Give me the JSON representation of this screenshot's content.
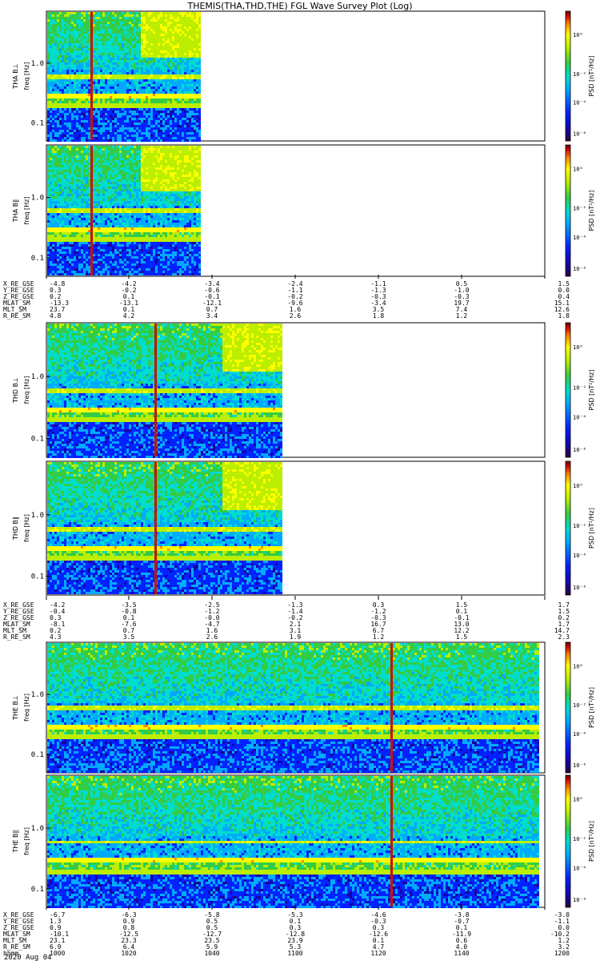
{
  "title": "THEMIS(THA,THD,THE) FGL Wave Survey Plot (Log)",
  "colors": {
    "colormap": [
      "#2a0033",
      "#1a00a0",
      "#0022ff",
      "#00aaff",
      "#00ddcc",
      "#33cc44",
      "#bbee00",
      "#ffff00",
      "#ff8800",
      "#cc1100",
      "#660000"
    ]
  },
  "panels": [
    {
      "ylabel_probe": "THA B⊥",
      "ylabel_unit": "freq [Hz]",
      "cb_label": "PSD [nT²/Hz]",
      "yticks": [
        "1.0",
        "0.1"
      ],
      "cb_ticks": [
        "10⁰",
        "10⁻²",
        "10⁻⁴",
        "10⁻⁶"
      ],
      "data_end_fraction": 0.305
    },
    {
      "ylabel_probe": "THA B∥",
      "ylabel_unit": "freq [Hz]",
      "cb_label": "PSD [nT²/Hz]",
      "yticks": [
        "1.0",
        "0.1"
      ],
      "cb_ticks": [
        "10⁰",
        "10⁻²",
        "10⁻⁴",
        "10⁻⁶"
      ],
      "data_end_fraction": 0.305
    },
    {
      "ylabel_probe": "THD B⊥",
      "ylabel_unit": "freq [Hz]",
      "cb_label": "PSD [nT²/Hz]",
      "yticks": [
        "1.0",
        "0.1"
      ],
      "cb_ticks": [
        "10⁰",
        "10⁻²",
        "10⁻⁴",
        "10⁻⁶"
      ],
      "data_end_fraction": 0.47
    },
    {
      "ylabel_probe": "THD B∥",
      "ylabel_unit": "freq [Hz]",
      "cb_label": "PSD [nT²/Hz]",
      "yticks": [
        "1.0",
        "0.1"
      ],
      "cb_ticks": [
        "10⁰",
        "10⁻²",
        "10⁻⁴",
        "10⁻⁶"
      ],
      "data_end_fraction": 0.47
    },
    {
      "ylabel_probe": "THE B⊥",
      "ylabel_unit": "freq [Hz]",
      "cb_label": "PSD [nT²/Hz]",
      "yticks": [
        "1.0",
        "0.1"
      ],
      "cb_ticks": [
        "10⁰",
        "10⁻²",
        "10⁻⁴",
        "10⁻⁶"
      ],
      "data_end_fraction": 0.99
    },
    {
      "ylabel_probe": "THE B∥",
      "ylabel_unit": "freq [Hz]",
      "cb_label": "PSD [nT²/Hz]",
      "yticks": [
        "1.0",
        "0.1"
      ],
      "cb_ticks": [
        "10⁰",
        "10⁻²",
        "10⁻⁴",
        "10⁻⁶"
      ],
      "data_end_fraction": 0.99
    }
  ],
  "ephemeris_blocks": [
    {
      "rows": [
        {
          "label": "X_RE_GSE",
          "values": [
            "-4.8",
            "-4.2",
            "-3.4",
            "-2.4",
            "-1.1",
            "0.5",
            "1.5"
          ]
        },
        {
          "label": "Y_RE_GSE",
          "values": [
            "0.3",
            "-0.2",
            "-0.6",
            "-1.1",
            "-1.3",
            "-1.0",
            "0.0"
          ]
        },
        {
          "label": "Z_RE_GSE",
          "values": [
            "0.2",
            "0.1",
            "-0.1",
            "-0.2",
            "-0.3",
            "-0.3",
            "0.4"
          ]
        },
        {
          "label": "MLAT_SM",
          "values": [
            "-13.3",
            "-13.1",
            "-12.1",
            "-9.6",
            "-3.4",
            "19.7",
            "15.1"
          ]
        },
        {
          "label": "MLT_SM",
          "values": [
            "23.7",
            "0.1",
            "0.7",
            "1.6",
            "3.5",
            "7.4",
            "12.6"
          ]
        },
        {
          "label": "R_RE_SM",
          "values": [
            "4.8",
            "4.2",
            "3.4",
            "2.6",
            "1.8",
            "1.2",
            "1.8"
          ]
        }
      ]
    },
    {
      "rows": [
        {
          "label": "X_RE_GSE",
          "values": [
            "-4.2",
            "-3.5",
            "-2.5",
            "-1.3",
            "0.3",
            "1.5",
            "1.7"
          ]
        },
        {
          "label": "Y_RE_GSE",
          "values": [
            "-0.4",
            "-0.8",
            "-1.2",
            "-1.4",
            "-1.2",
            "0.1",
            "1.5"
          ]
        },
        {
          "label": "Z_RE_GSE",
          "values": [
            "0.3",
            "0.1",
            "-0.0",
            "-0.2",
            "-0.3",
            "-0.1",
            "0.2"
          ]
        },
        {
          "label": "MLAT_SM",
          "values": [
            "-8.1",
            "-7.6",
            "-4.7",
            "2.1",
            "16.7",
            "13.0",
            "1.7"
          ]
        },
        {
          "label": "MLT_SM",
          "values": [
            "0.2",
            "0.7",
            "1.6",
            "3.1",
            "6.7",
            "12.2",
            "14.7"
          ]
        },
        {
          "label": "R_RE_SM",
          "values": [
            "4.3",
            "3.5",
            "2.6",
            "1.9",
            "1.2",
            "1.5",
            "2.3"
          ]
        }
      ]
    },
    {
      "rows": [
        {
          "label": "X_RE_GSE",
          "values": [
            "-6.7",
            "-6.3",
            "-5.8",
            "-5.3",
            "-4.6",
            "-3.8",
            "-3.0"
          ]
        },
        {
          "label": "Y_RE_GSE",
          "values": [
            "1.3",
            "0.9",
            "0.5",
            "0.1",
            "-0.3",
            "-0.7",
            "-1.1"
          ]
        },
        {
          "label": "Z_RE_GSE",
          "values": [
            "0.9",
            "0.8",
            "0.5",
            "0.3",
            "0.3",
            "0.1",
            "0.0"
          ]
        },
        {
          "label": "MLAT_SM",
          "values": [
            "-10.1",
            "-12.5",
            "-12.7",
            "-12.8",
            "-12.6",
            "-11.9",
            "-10.2"
          ]
        },
        {
          "label": "MLT_SM",
          "values": [
            "23.1",
            "23.3",
            "23.5",
            "23.9",
            "0.1",
            "0.6",
            "1.2"
          ]
        },
        {
          "label": "R_RE_SM",
          "values": [
            "6.9",
            "6.4",
            "5.9",
            "5.3",
            "4.7",
            "4.0",
            "3.2"
          ]
        },
        {
          "label": "hhmm",
          "values": [
            "1000",
            "1020",
            "1040",
            "1100",
            "1120",
            "1140",
            "1200"
          ]
        }
      ]
    }
  ],
  "date_label": "2020 Aug 04",
  "chart_data": {
    "type": "heatmap",
    "title": "THEMIS(THA,THD,THE) FGL Wave Survey Plot (Log)",
    "x_axis": {
      "label": "hhmm",
      "ticks": [
        "1000",
        "1020",
        "1040",
        "1100",
        "1120",
        "1140",
        "1200"
      ]
    },
    "y_axis": {
      "label": "freq [Hz]",
      "scale": "log",
      "ticks": [
        1.0,
        0.1
      ]
    },
    "colorbar": {
      "label": "PSD [nT²/Hz]",
      "scale": "log",
      "range": [
        -6,
        0
      ]
    },
    "series": [
      {
        "name": "THA B⊥",
        "coverage_end_hhmm": "1037"
      },
      {
        "name": "THA B∥",
        "coverage_end_hhmm": "1037"
      },
      {
        "name": "THD B⊥",
        "coverage_end_hhmm": "1056"
      },
      {
        "name": "THD B∥",
        "coverage_end_hhmm": "1056"
      },
      {
        "name": "THE B⊥",
        "coverage_end_hhmm": "1200"
      },
      {
        "name": "THE B∥",
        "coverage_end_hhmm": "1200"
      }
    ]
  }
}
